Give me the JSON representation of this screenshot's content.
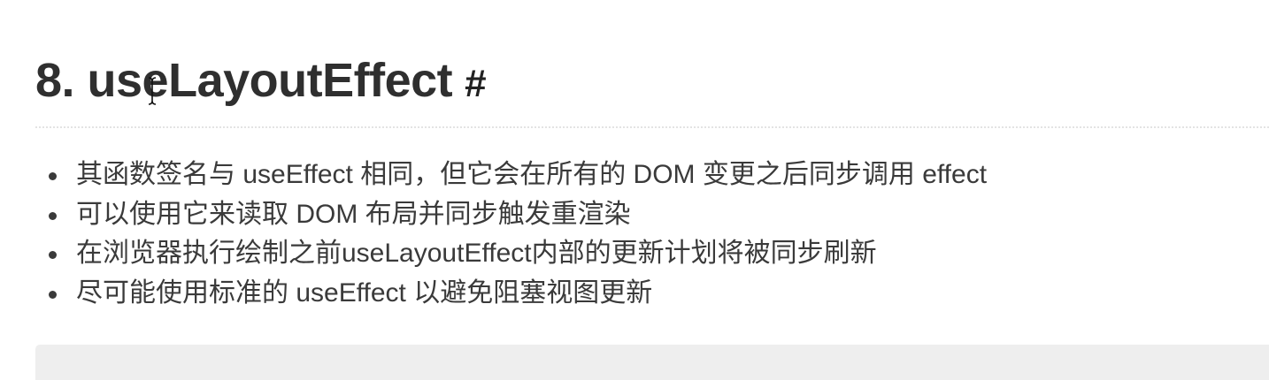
{
  "section": {
    "heading": "8. useLayoutEffect",
    "anchor": "#"
  },
  "bullets": [
    "其函数签名与 useEffect 相同，但它会在所有的 DOM 变更之后同步调用 effect",
    "可以使用它来读取 DOM 布局并同步触发重渲染",
    "在浏览器执行绘制之前useLayoutEffect内部的更新计划将被同步刷新",
    "尽可能使用标准的 useEffect 以避免阻塞视图更新"
  ],
  "icons": {
    "cursor": "text-cursor-icon"
  }
}
